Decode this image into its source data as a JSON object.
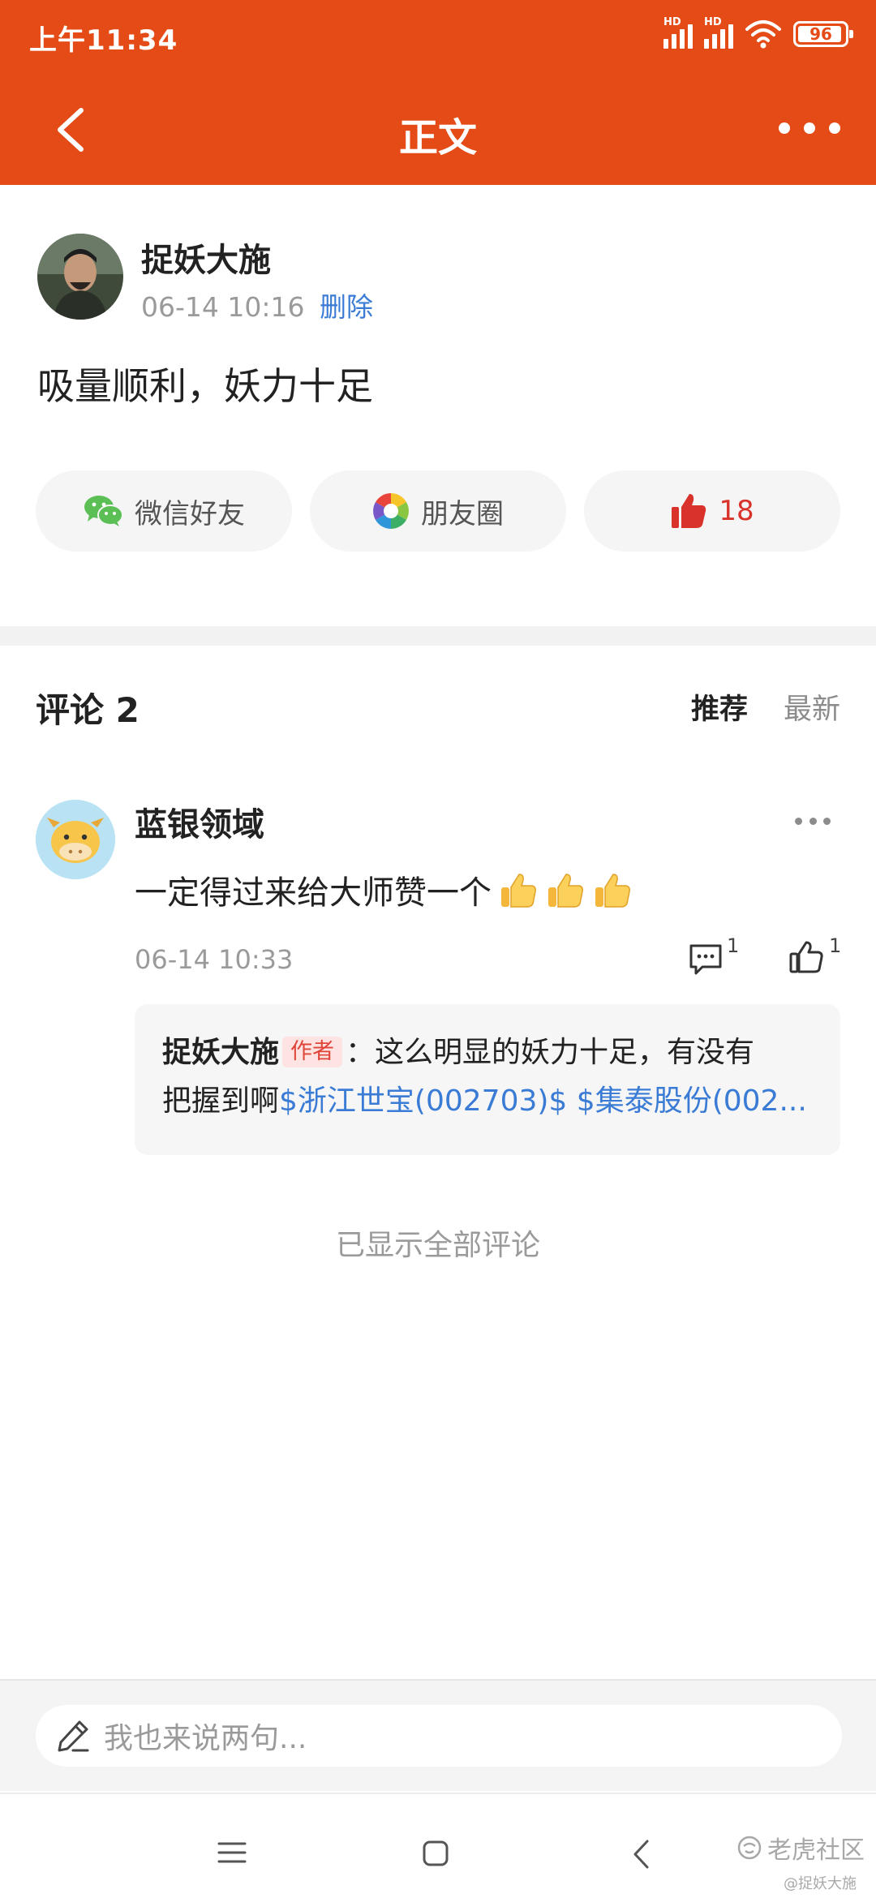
{
  "status_bar": {
    "time": "上午11:34",
    "hd1": "HD",
    "hd2": "HD",
    "battery": "96"
  },
  "nav": {
    "title": "正文"
  },
  "post": {
    "author": "捉妖大施",
    "time": "06-14 10:16",
    "delete_label": "删除",
    "content": "吸量顺利，妖力十足"
  },
  "share": {
    "wechat_label": "微信好友",
    "moments_label": "朋友圈",
    "like_count": "18"
  },
  "comments": {
    "title": "评论 2",
    "sort_recommended": "推荐",
    "sort_latest": "最新",
    "items": [
      {
        "user": "蓝银领域",
        "text": "一定得过来给大师赞一个",
        "emoji": "thumbs-up-emoji",
        "time": "06-14 10:33",
        "reply_count": "1",
        "like_count": "1",
        "reply": {
          "author": "捉妖大施",
          "tag": "作者",
          "colon": "：",
          "text1": "这么明显的妖力十足，有没有",
          "text2": "把握到啊",
          "stock1": "$浙江世宝(002703)$",
          "stock2": "$集泰股份(002..."
        }
      }
    ],
    "all_shown": "已显示全部评论"
  },
  "input": {
    "placeholder": "我也来说两句..."
  },
  "watermark": {
    "brand": "老虎社区",
    "sub": "@捉妖大施"
  },
  "colors": {
    "header": "#e54b16",
    "link": "#3a7bd5",
    "like_red": "#d9322b"
  }
}
